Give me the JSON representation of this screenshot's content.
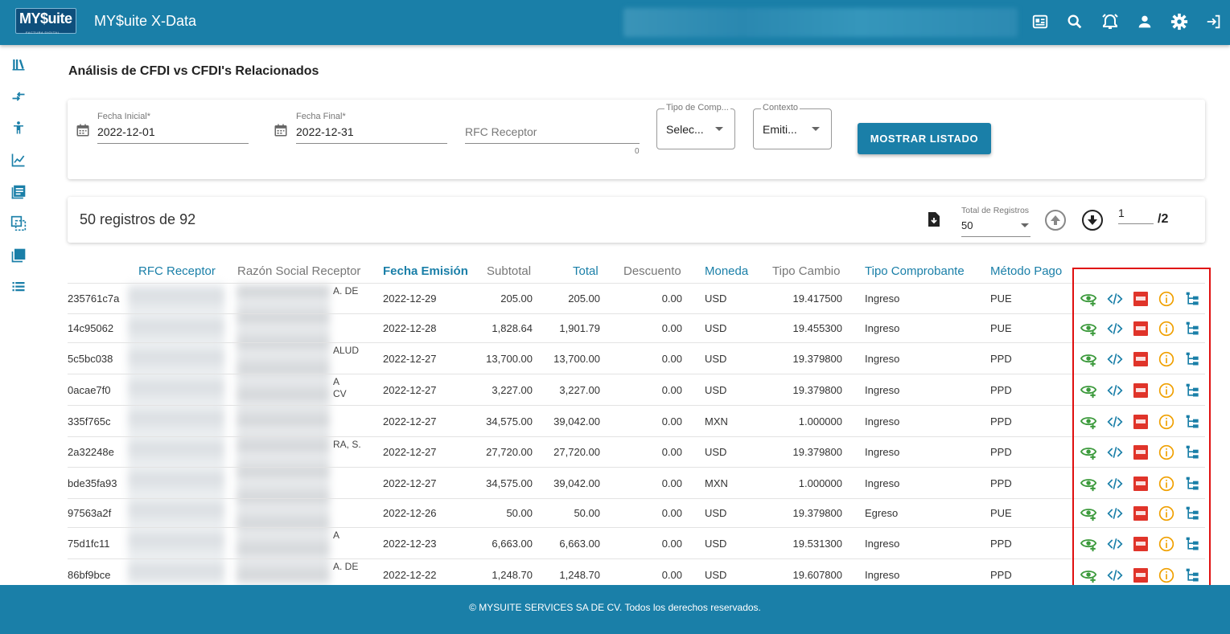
{
  "header": {
    "logo_text": "MY$uite",
    "logo_sub": "FACTURA DIGITAL",
    "app_title": "MY$uite X-Data",
    "icons": [
      "news-icon",
      "search-icon",
      "alarm-icon",
      "user-icon",
      "gear-icon",
      "logout-icon"
    ]
  },
  "sidebar": {
    "icons": [
      "library-icon",
      "compare-arrows-icon",
      "accessibility-icon",
      "chart-line-icon",
      "list-book-icon",
      "copy-icon",
      "library-books-icon",
      "list-icon"
    ]
  },
  "page": {
    "title": "Análisis de CFDI vs CFDI's Relacionados"
  },
  "filters": {
    "fecha_inicial_label": "Fecha Inicial*",
    "fecha_inicial_value": "2022-12-01",
    "fecha_final_label": "Fecha Final*",
    "fecha_final_value": "2022-12-31",
    "rfc_placeholder": "RFC Receptor",
    "rfc_counter": "0",
    "tipo_label": "Tipo de Comp...",
    "tipo_value": "Selec...",
    "contexto_label": "Contexto",
    "contexto_value": "Emiti...",
    "show_button": "MOSTRAR LISTADO"
  },
  "summary": {
    "text": "50 registros de 92",
    "total_label": "Total de Registros",
    "total_value": "50",
    "page_current": "1",
    "page_total": "/2"
  },
  "table": {
    "headers": {
      "rfc": "RFC Receptor",
      "razon": "Razón Social Receptor",
      "fecha": "Fecha Emisión",
      "subtotal": "Subtotal",
      "total": "Total",
      "descuento": "Descuento",
      "moneda": "Moneda",
      "tipo_cambio": "Tipo Cambio",
      "tipo_comprobante": "Tipo Comprobante",
      "metodo_pago": "Método Pago"
    },
    "rows": [
      {
        "uuid": "235761c7a",
        "razon": "A. DE",
        "fecha": "2022-12-29",
        "subtotal": "205.00",
        "total": "205.00",
        "descuento": "0.00",
        "moneda": "USD",
        "tipo_cambio": "19.417500",
        "tipo": "Ingreso",
        "metodo": "PUE"
      },
      {
        "uuid": "14c95062",
        "razon": "",
        "fecha": "2022-12-28",
        "subtotal": "1,828.64",
        "total": "1,901.79",
        "descuento": "0.00",
        "moneda": "USD",
        "tipo_cambio": "19.455300",
        "tipo": "Ingreso",
        "metodo": "PUE"
      },
      {
        "uuid": "5c5bc038",
        "razon": "ALUD",
        "fecha": "2022-12-27",
        "subtotal": "13,700.00",
        "total": "13,700.00",
        "descuento": "0.00",
        "moneda": "USD",
        "tipo_cambio": "19.379800",
        "tipo": "Ingreso",
        "metodo": "PPD"
      },
      {
        "uuid": "0acae7f0",
        "razon": "A\nCV",
        "fecha": "2022-12-27",
        "subtotal": "3,227.00",
        "total": "3,227.00",
        "descuento": "0.00",
        "moneda": "USD",
        "tipo_cambio": "19.379800",
        "tipo": "Ingreso",
        "metodo": "PPD"
      },
      {
        "uuid": "335f765c",
        "razon": "",
        "fecha": "2022-12-27",
        "subtotal": "34,575.00",
        "total": "39,042.00",
        "descuento": "0.00",
        "moneda": "MXN",
        "tipo_cambio": "1.000000",
        "tipo": "Ingreso",
        "metodo": "PPD"
      },
      {
        "uuid": "2a32248e",
        "razon": "RA, S.",
        "fecha": "2022-12-27",
        "subtotal": "27,720.00",
        "total": "27,720.00",
        "descuento": "0.00",
        "moneda": "USD",
        "tipo_cambio": "19.379800",
        "tipo": "Ingreso",
        "metodo": "PPD"
      },
      {
        "uuid": "bde35fa93",
        "razon": "",
        "fecha": "2022-12-27",
        "subtotal": "34,575.00",
        "total": "39,042.00",
        "descuento": "0.00",
        "moneda": "MXN",
        "tipo_cambio": "1.000000",
        "tipo": "Ingreso",
        "metodo": "PPD"
      },
      {
        "uuid": "97563a2f",
        "razon": "",
        "fecha": "2022-12-26",
        "subtotal": "50.00",
        "total": "50.00",
        "descuento": "0.00",
        "moneda": "USD",
        "tipo_cambio": "19.379800",
        "tipo": "Egreso",
        "metodo": "PUE"
      },
      {
        "uuid": "75d1fc11",
        "razon": "A",
        "fecha": "2022-12-23",
        "subtotal": "6,663.00",
        "total": "6,663.00",
        "descuento": "0.00",
        "moneda": "USD",
        "tipo_cambio": "19.531300",
        "tipo": "Ingreso",
        "metodo": "PPD"
      },
      {
        "uuid": "86bf9bce",
        "razon": "A. DE",
        "fecha": "2022-12-22",
        "subtotal": "1,248.70",
        "total": "1,248.70",
        "descuento": "0.00",
        "moneda": "USD",
        "tipo_cambio": "19.607800",
        "tipo": "Ingreso",
        "metodo": "PPD"
      }
    ],
    "action_icons": [
      "view-related-icon",
      "xml-code-icon",
      "pdf-icon",
      "info-icon",
      "tree-icon"
    ]
  },
  "colors": {
    "primary": "#1a7fa8",
    "green": "#3c9a3c",
    "orange": "#f0a000",
    "pdf_red": "#e0342a",
    "highlight": "#e01010"
  },
  "footer": {
    "text": "© MYSUITE SERVICES SA DE CV. Todos los derechos reservados."
  }
}
